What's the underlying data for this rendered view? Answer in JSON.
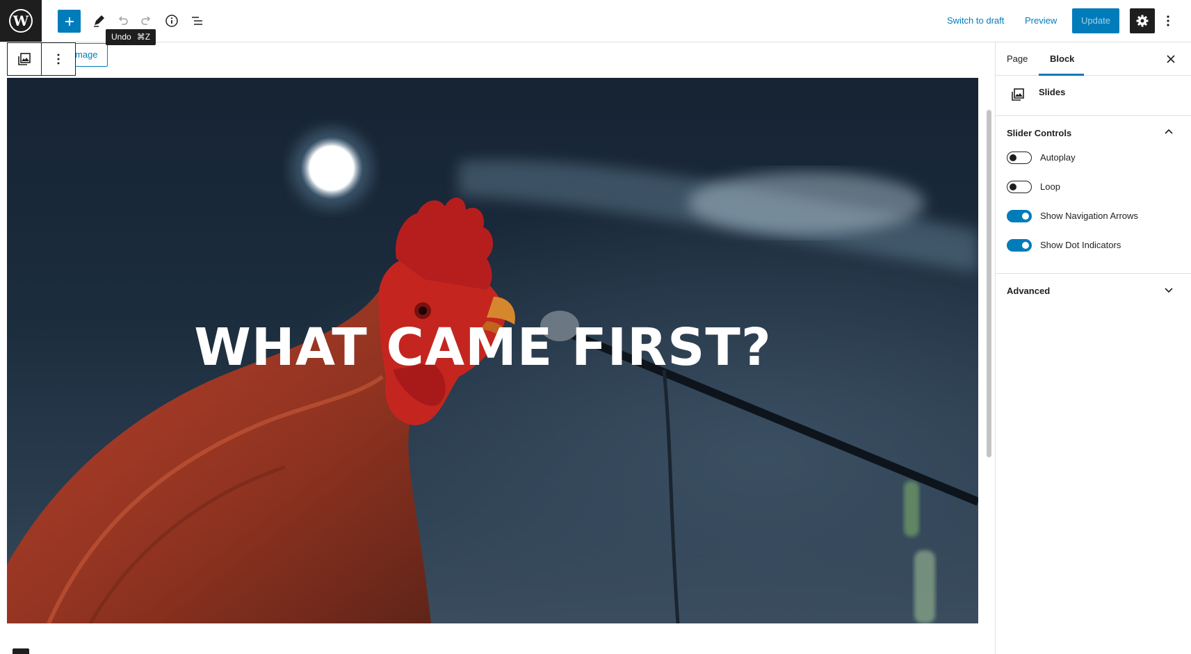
{
  "header": {
    "tooltip_label": "Undo",
    "tooltip_shortcut": "⌘Z",
    "switch_to_draft": "Switch to draft",
    "preview": "Preview",
    "update": "Update"
  },
  "block_toolbar": {
    "replace_label": "mage"
  },
  "canvas": {
    "hero_title": "WHAT CAME FIRST?"
  },
  "sidebar": {
    "tabs": [
      {
        "label": "Page",
        "active": false
      },
      {
        "label": "Block",
        "active": true
      }
    ],
    "block_name": "Slides",
    "panels": {
      "slider_controls": {
        "title": "Slider Controls",
        "expanded": true,
        "toggles": [
          {
            "label": "Autoplay",
            "on": false
          },
          {
            "label": "Loop",
            "on": false
          },
          {
            "label": "Show Navigation Arrows",
            "on": true
          },
          {
            "label": "Show Dot Indicators",
            "on": true
          }
        ]
      },
      "advanced": {
        "title": "Advanced",
        "expanded": false
      }
    }
  },
  "colors": {
    "accent": "#007cba",
    "dark": "#1e1e1e"
  },
  "icons": [
    "wordpress-logo-icon",
    "plus-icon",
    "pencil-icon",
    "undo-icon",
    "redo-icon",
    "info-icon",
    "list-view-icon",
    "gear-icon",
    "more-vertical-icon",
    "gallery-block-icon",
    "close-icon",
    "chevron-up-icon",
    "chevron-down-icon"
  ]
}
